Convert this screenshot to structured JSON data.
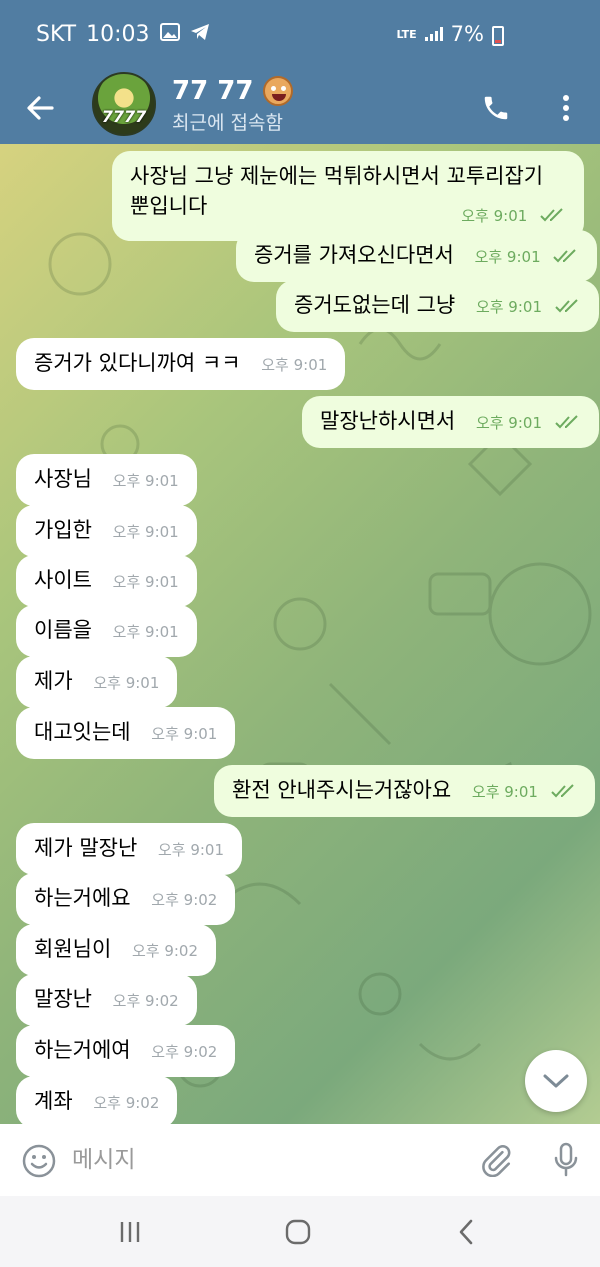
{
  "status_bar": {
    "carrier": "SKT",
    "time": "10:03",
    "network": "LTE",
    "battery": "7%"
  },
  "header": {
    "chat_name": "77 77",
    "avatar_text": "7777",
    "status": "최근에 접속함"
  },
  "messages": [
    {
      "dir": "out",
      "text": "사장님 그냥 제눈에는 먹튀하시면서 꼬투리잡기\n뿐입니다",
      "time": "오후 9:01"
    },
    {
      "dir": "out",
      "text": "증거를 가져오신다면서",
      "time": "오후 9:01"
    },
    {
      "dir": "out",
      "text": "증거도없는데 그냥",
      "time": "오후 9:01"
    },
    {
      "dir": "in",
      "text": "증거가 있다니까여 ㅋㅋ",
      "time": "오후 9:01"
    },
    {
      "dir": "out",
      "text": "말장난하시면서",
      "time": "오후 9:01"
    },
    {
      "dir": "in",
      "text": "사장님",
      "time": "오후 9:01"
    },
    {
      "dir": "in",
      "text": "가입한",
      "time": "오후 9:01"
    },
    {
      "dir": "in",
      "text": "사이트",
      "time": "오후 9:01"
    },
    {
      "dir": "in",
      "text": "이름을",
      "time": "오후 9:01"
    },
    {
      "dir": "in",
      "text": "제가",
      "time": "오후 9:01"
    },
    {
      "dir": "in",
      "text": "대고잇는데",
      "time": "오후 9:01"
    },
    {
      "dir": "out",
      "text": "환전 안내주시는거잖아요",
      "time": "오후 9:01"
    },
    {
      "dir": "in",
      "text": "제가 말장난",
      "time": "오후 9:01"
    },
    {
      "dir": "in",
      "text": "하는거에요",
      "time": "오후 9:02"
    },
    {
      "dir": "in",
      "text": "회원님이",
      "time": "오후 9:02"
    },
    {
      "dir": "in",
      "text": "말장난",
      "time": "오후 9:02"
    },
    {
      "dir": "in",
      "text": "하는거에여",
      "time": "오후 9:02"
    },
    {
      "dir": "in",
      "text": "계좌",
      "time": "오후 9:02"
    }
  ],
  "input": {
    "placeholder": "메시지",
    "value": ""
  },
  "colors": {
    "header_bg": "#517da2",
    "outgoing_bubble": "#effdde",
    "incoming_bubble": "#ffffff",
    "read_ticks": "#6dab5f"
  },
  "icons": [
    "back-arrow-icon",
    "phone-icon",
    "more-vert-icon",
    "emoji-icon",
    "attach-icon",
    "mic-icon",
    "chevron-down-icon",
    "recent-apps-icon",
    "home-icon",
    "back-nav-icon"
  ]
}
